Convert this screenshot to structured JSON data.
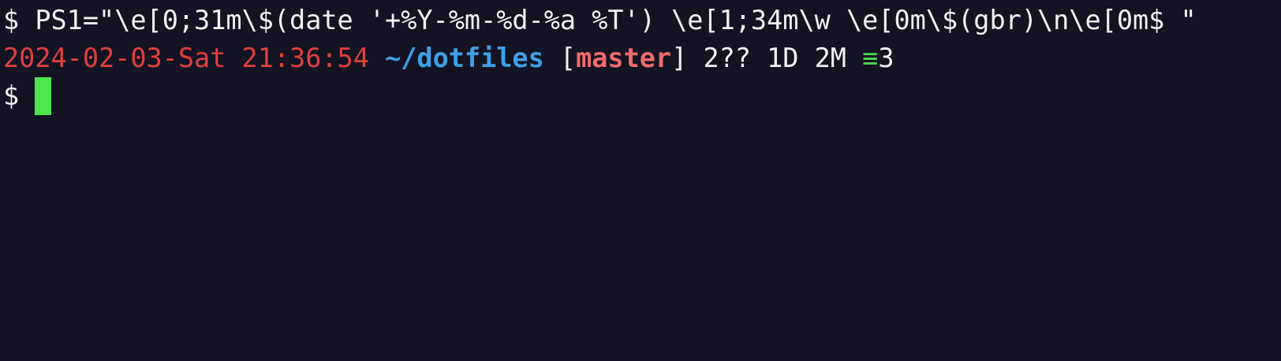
{
  "terminal": {
    "background": "#131324",
    "colors": {
      "default": "#f2f2f2",
      "date": "#e0403a",
      "directory": "#3f9fe6",
      "branch": "#f06b6b",
      "ahead_marker": "#4ed74e",
      "cursor": "#4ee84e"
    },
    "command_line": {
      "prompt": "$ ",
      "command": "PS1=\"\\e[0;31m\\$(date '+%Y-%m-%d-%a %T') \\e[1;34m\\w \\e[0m\\$(gbr)\\n\\e[0m$ \""
    },
    "status_line": {
      "datetime": "2024-02-03-Sat 21:36:54",
      "directory": "~/dotfiles",
      "bracket_open": "[",
      "branch": "master",
      "bracket_close": "]",
      "git_status": "2?? 1D 2M",
      "ahead_symbol": "≡",
      "ahead_count": "3"
    },
    "input_line": {
      "prompt": "$ ",
      "value": ""
    }
  }
}
